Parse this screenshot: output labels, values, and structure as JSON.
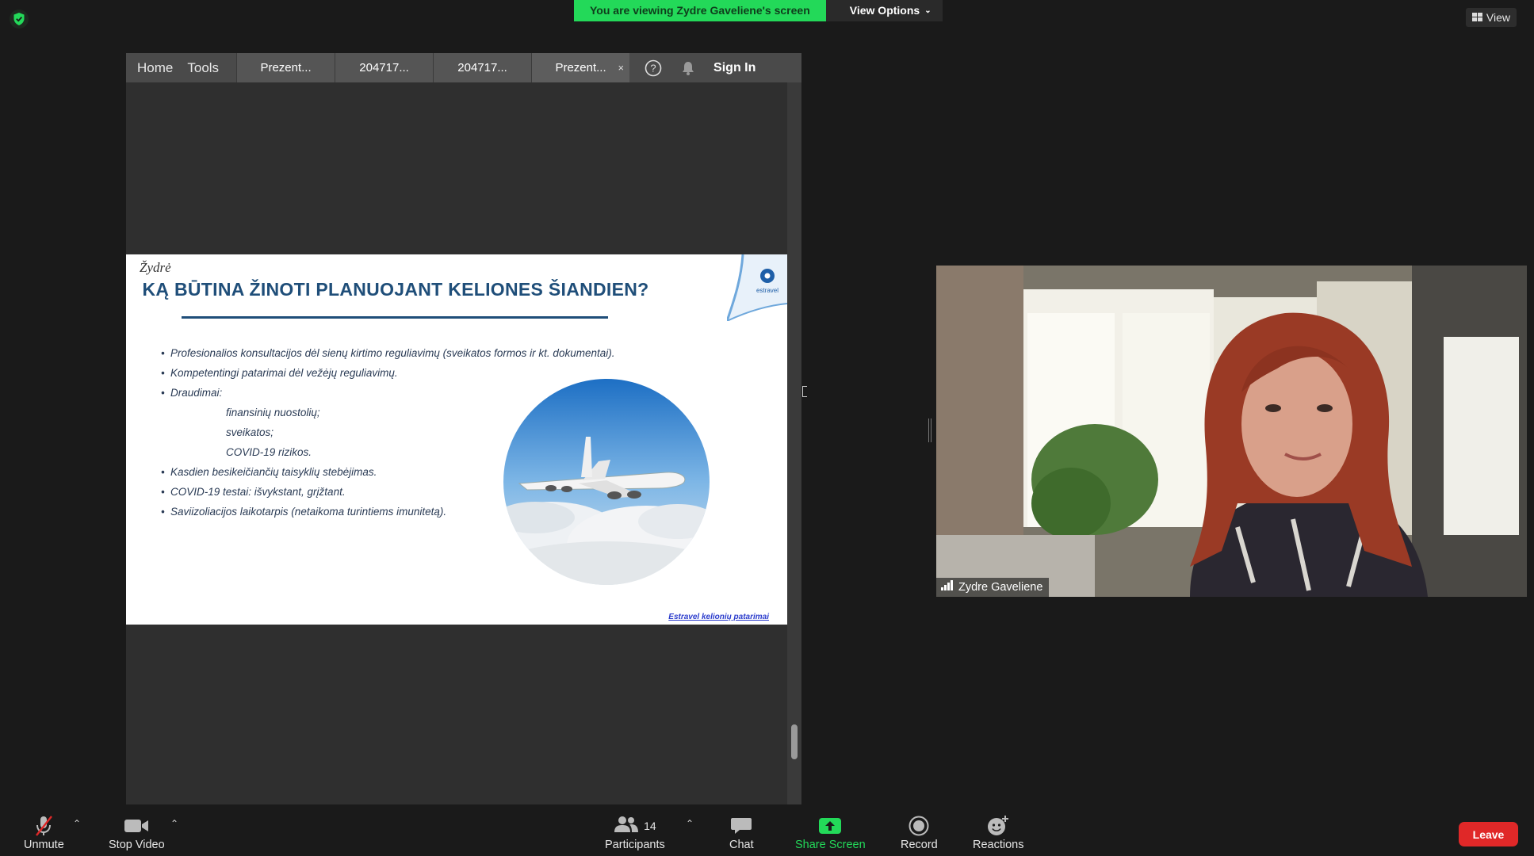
{
  "banner": {
    "viewing_text": "You are viewing Zydre Gaveliene's screen",
    "options_label": "View Options"
  },
  "view_button": {
    "label": "View"
  },
  "shared_screen": {
    "nav": {
      "home": "Home",
      "tools": "Tools"
    },
    "tabs": [
      {
        "label": "Prezent..."
      },
      {
        "label": "204717..."
      },
      {
        "label": "204717..."
      },
      {
        "label": "Prezent...",
        "active": true,
        "close": "×"
      }
    ],
    "sign_in": "Sign In",
    "slide": {
      "author": "Žydrė",
      "title": "KĄ BŪTINA ŽINOTI PLANUOJANT KELIONES ŠIANDIEN?",
      "logo_text": "estravel",
      "items": [
        "Profesionalios konsultacijos dėl sienų kirtimo reguliavimų (sveikatos formos ir kt. dokumentai).",
        "Kompetentingi patarimai dėl vežėjų reguliavimų.",
        "Draudimai:",
        "finansinių nuostolių;",
        "sveikatos;",
        "COVID-19 rizikos.",
        "Kasdien besikeičiančių taisyklių stebėjimas.",
        "COVID-19 testai: išvykstant, grįžtant.",
        "Saviizoliacijos laikotarpis (netaikoma turintiems imunitetą)."
      ],
      "link": "Estravel kelionių patarimai"
    }
  },
  "participant_tile": {
    "name": "Zydre Gaveliene"
  },
  "toolbar": {
    "unmute": "Unmute",
    "stop_video": "Stop Video",
    "participants": "Participants",
    "participants_count": "14",
    "chat": "Chat",
    "share_screen": "Share Screen",
    "record": "Record",
    "reactions": "Reactions",
    "leave": "Leave"
  },
  "colors": {
    "banner_green": "#23d959",
    "leave_red": "#e02828",
    "slide_title_blue": "#1f4e79"
  }
}
